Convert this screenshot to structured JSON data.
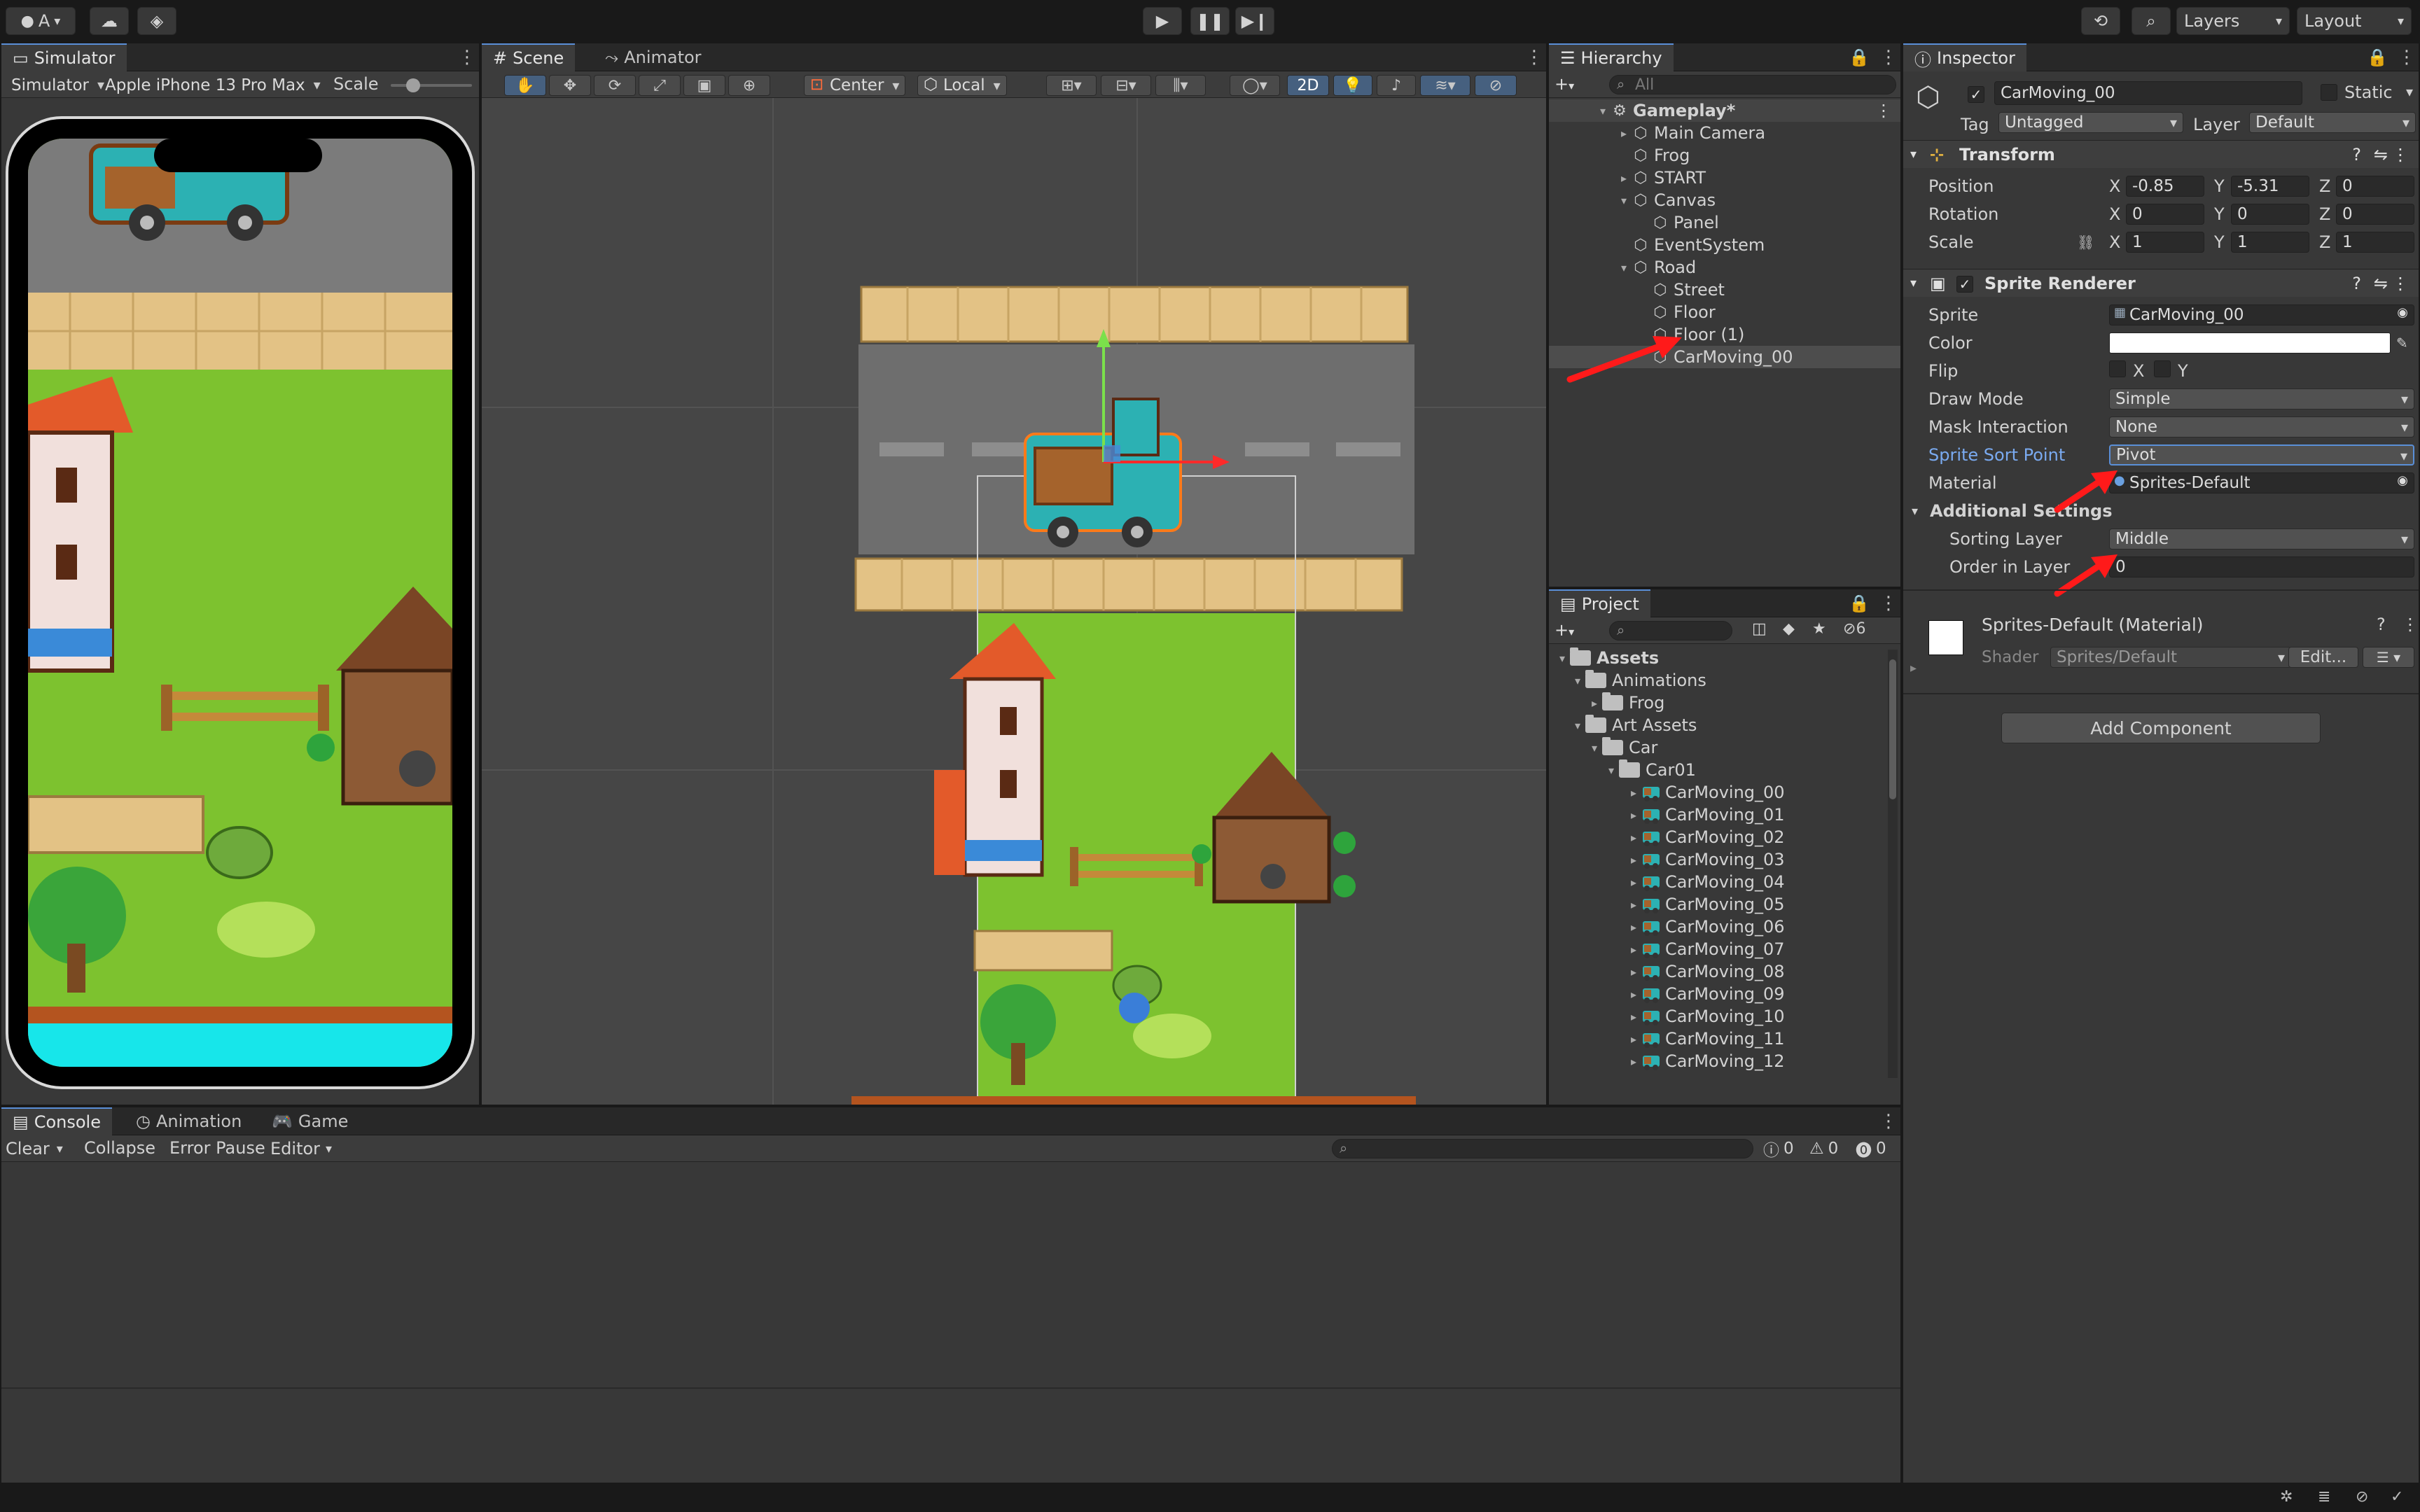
{
  "toolbar": {
    "account_label": "A",
    "layers_label": "Layers",
    "layout_label": "Layout"
  },
  "simulator": {
    "tab_label": "Simulator",
    "mode_label": "Simulator",
    "device_label": "Apple iPhone 13 Pro Max",
    "scale_label": "Scale"
  },
  "scene": {
    "tab_label": "Scene",
    "animator_tab_label": "Animator",
    "pivot_label": "Center",
    "space_label": "Local",
    "mode_2d_label": "2D"
  },
  "hierarchy": {
    "tab_label": "Hierarchy",
    "search_placeholder": "All",
    "items": [
      {
        "label": "Gameplay*"
      },
      {
        "label": "Main Camera"
      },
      {
        "label": "Frog"
      },
      {
        "label": "START"
      },
      {
        "label": "Canvas"
      },
      {
        "label": "Panel"
      },
      {
        "label": "EventSystem"
      },
      {
        "label": "Road"
      },
      {
        "label": "Street"
      },
      {
        "label": "Floor"
      },
      {
        "label": "Floor (1)"
      },
      {
        "label": "CarMoving_00"
      }
    ]
  },
  "project": {
    "tab_label": "Project",
    "hidden_count": "6",
    "items": [
      {
        "label": "Assets"
      },
      {
        "label": "Animations"
      },
      {
        "label": "Frog"
      },
      {
        "label": "Art Assets"
      },
      {
        "label": "Car"
      },
      {
        "label": "Car01"
      },
      {
        "label": "CarMoving_00"
      },
      {
        "label": "CarMoving_01"
      },
      {
        "label": "CarMoving_02"
      },
      {
        "label": "CarMoving_03"
      },
      {
        "label": "CarMoving_04"
      },
      {
        "label": "CarMoving_05"
      },
      {
        "label": "CarMoving_06"
      },
      {
        "label": "CarMoving_07"
      },
      {
        "label": "CarMoving_08"
      },
      {
        "label": "CarMoving_09"
      },
      {
        "label": "CarMoving_10"
      },
      {
        "label": "CarMoving_11"
      },
      {
        "label": "CarMoving_12"
      }
    ]
  },
  "inspector": {
    "tab_label": "Inspector",
    "object_name": "CarMoving_00",
    "static_label": "Static",
    "tag_label": "Tag",
    "tag_value": "Untagged",
    "layer_label": "Layer",
    "layer_value": "Default",
    "transform": {
      "title": "Transform",
      "position_label": "Position",
      "rotation_label": "Rotation",
      "scale_label": "Scale",
      "x_label": "X",
      "y_label": "Y",
      "z_label": "Z",
      "position": {
        "x": "-0.85",
        "y": "-5.31",
        "z": "0"
      },
      "rotation": {
        "x": "0",
        "y": "0",
        "z": "0"
      },
      "scale": {
        "x": "1",
        "y": "1",
        "z": "1"
      }
    },
    "sprite_renderer": {
      "title": "Sprite Renderer",
      "sprite_label": "Sprite",
      "sprite_value": "CarMoving_00",
      "color_label": "Color",
      "color_value": "#ffffff",
      "flip_label": "Flip",
      "flip_x": "X",
      "flip_y": "Y",
      "draw_mode_label": "Draw Mode",
      "draw_mode_value": "Simple",
      "mask_label": "Mask Interaction",
      "mask_value": "None",
      "sort_point_label": "Sprite Sort Point",
      "sort_point_value": "Pivot",
      "material_label": "Material",
      "material_value": "Sprites-Default",
      "additional_label": "Additional Settings",
      "sorting_layer_label": "Sorting Layer",
      "sorting_layer_value": "Middle",
      "order_label": "Order in Layer",
      "order_value": "0"
    },
    "material": {
      "title": "Sprites-Default (Material)",
      "shader_label": "Shader",
      "shader_value": "Sprites/Default",
      "edit_label": "Edit..."
    },
    "add_component_label": "Add Component"
  },
  "console": {
    "tabs": [
      {
        "label": "Console"
      },
      {
        "label": "Animation"
      },
      {
        "label": "Game"
      }
    ],
    "clear_label": "Clear",
    "collapse_label": "Collapse",
    "error_pause_label": "Error Pause",
    "editor_label": "Editor",
    "log_count": "0",
    "warning_count": "0",
    "error_count": "0"
  },
  "colors": {
    "accent": "#5a8fd8",
    "selection": "#4d4d4d",
    "annotation_arrow": "#ff1a1a",
    "grass": "#7dc22f",
    "road": "#6e6e6e"
  }
}
